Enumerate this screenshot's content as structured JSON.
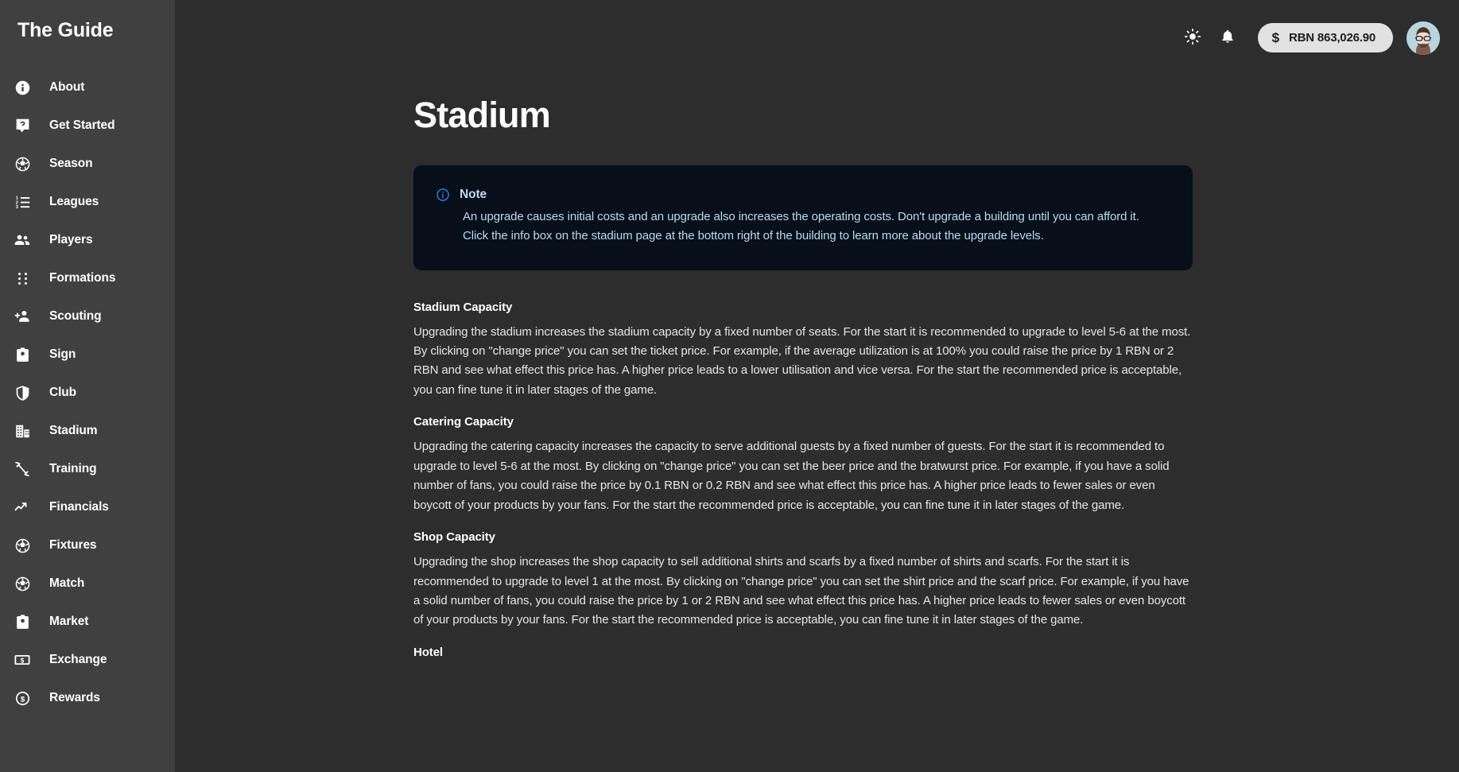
{
  "sidebar": {
    "brand": "The Guide",
    "items": [
      {
        "label": "About",
        "icon": "info-circle-icon"
      },
      {
        "label": "Get Started",
        "icon": "question-help-icon"
      },
      {
        "label": "Season",
        "icon": "soccer-ball-icon"
      },
      {
        "label": "Leagues",
        "icon": "ordered-list-icon"
      },
      {
        "label": "Players",
        "icon": "people-group-icon"
      },
      {
        "label": "Formations",
        "icon": "grid-dots-icon"
      },
      {
        "label": "Scouting",
        "icon": "person-add-icon"
      },
      {
        "label": "Sign",
        "icon": "id-badge-icon"
      },
      {
        "label": "Club",
        "icon": "shield-icon"
      },
      {
        "label": "Stadium",
        "icon": "building-icon"
      },
      {
        "label": "Training",
        "icon": "dumbbell-icon"
      },
      {
        "label": "Financials",
        "icon": "trend-up-icon"
      },
      {
        "label": "Fixtures",
        "icon": "soccer-ball-icon"
      },
      {
        "label": "Match",
        "icon": "soccer-ball-icon"
      },
      {
        "label": "Market",
        "icon": "id-badge-icon"
      },
      {
        "label": "Exchange",
        "icon": "banknote-icon"
      },
      {
        "label": "Rewards",
        "icon": "dollar-coin-icon"
      }
    ]
  },
  "topbar": {
    "theme_toggle_icon": "sun-icon",
    "notifications_icon": "bell-icon",
    "balance": {
      "currency_icon": "dollar-sign-icon",
      "amount": "RBN 863,026.90"
    },
    "avatar_icon": "user-avatar"
  },
  "page": {
    "title": "Stadium",
    "note": {
      "icon": "info-circle-icon",
      "title": "Note",
      "body": "An upgrade causes initial costs and an upgrade also increases the operating costs. Don't upgrade a building until you can afford it. Click the info box on the stadium page at the bottom right of the building to learn more about the upgrade levels."
    },
    "sections": [
      {
        "heading": "Stadium Capacity",
        "text": "Upgrading the stadium increases the stadium capacity by a fixed number of seats. For the start it is recommended to upgrade to level 5-6 at the most. By clicking on \"change price\" you can set the ticket price. For example, if the average utilization is at 100% you could raise the price by 1 RBN or 2 RBN and see what effect this price has. A higher price leads to a lower utilisation and vice versa. For the start the recommended price is acceptable, you can fine tune it in later stages of the game."
      },
      {
        "heading": "Catering Capacity",
        "text": "Upgrading the catering capacity increases the capacity to serve additional guests by a fixed number of guests. For the start it is recommended to upgrade to level 5-6 at the most. By clicking on \"change price\" you can set the beer price and the bratwurst price. For example, if you have a solid number of fans, you could raise the price by 0.1 RBN or 0.2 RBN and see what effect this price has. A higher price leads to fewer sales or even boycott of your products by your fans. For the start the recommended price is acceptable, you can fine tune it in later stages of the game."
      },
      {
        "heading": "Shop Capacity",
        "text": "Upgrading the shop increases the shop capacity to sell additional shirts and scarfs by a fixed number of shirts and scarfs. For the start it is recommended to upgrade to level 1 at the most. By clicking on \"change price\" you can set the shirt price and the scarf price. For example, if you have a solid number of fans, you could raise the price by 1 or 2 RBN and see what effect this price has. A higher price leads to fewer sales or even boycott of your products by your fans. For the start the recommended price is acceptable, you can fine tune it in later stages of the game."
      },
      {
        "heading": "Hotel",
        "text": ""
      }
    ]
  },
  "colors": {
    "sidebar_bg": "#404040",
    "main_bg": "#2d2d2d",
    "note_bg": "#060f1a",
    "note_accent": "#2f8ae0",
    "note_text": "#bcd9f2",
    "pill_bg": "#e2e2e2"
  }
}
